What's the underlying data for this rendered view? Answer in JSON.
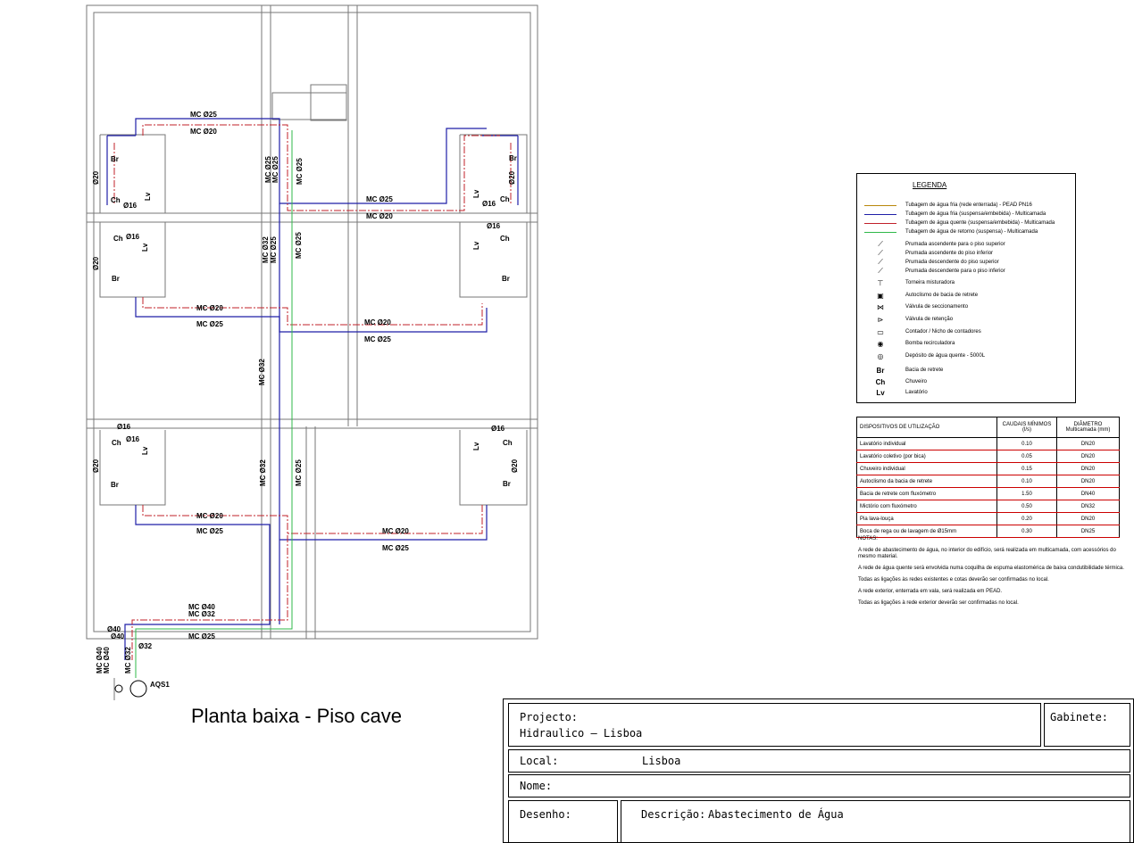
{
  "plan": {
    "title": "Planta baixa - Piso cave",
    "pipe_labels": [
      "MC Ø25",
      "MC Ø20",
      "MC Ø25",
      "MC Ø20",
      "MC Ø20",
      "MC Ø25",
      "MC Ø20",
      "MC Ø25",
      "MC Ø20",
      "MC Ø25",
      "MC Ø20",
      "MC Ø25",
      "MC Ø40",
      "MC Ø32",
      "MC Ø25"
    ],
    "vertical_labels": [
      "MC Ø25",
      "MC Ø25",
      "MC Ø25",
      "MC Ø32",
      "MC Ø25",
      "MC Ø25",
      "MC Ø32",
      "MC Ø32",
      "MC Ø25",
      "MC Ø40",
      "MC Ø40",
      "MC Ø32"
    ],
    "fixture_labels": [
      "Br",
      "Ch",
      "Lv",
      "Ø16",
      "Ø20"
    ],
    "aqs_label": "AQS1",
    "small_labels": [
      "Ø40",
      "Ø40",
      "Ø32"
    ]
  },
  "legend": {
    "title": "LEGENDA",
    "items": [
      {
        "symbol": "line",
        "color": "#b8860b",
        "text": "Tubagem de água fria (rede enterrada) - PEAD PN16"
      },
      {
        "symbol": "line",
        "color": "#1f1fa8",
        "text": "Tubagem de água fria (suspensa/embebida) - Multicamada"
      },
      {
        "symbol": "line",
        "color": "#c0202a",
        "text": "Tubagem de água quente (suspensa/embebida) - Multicamada"
      },
      {
        "symbol": "line",
        "color": "#2fb84a",
        "text": "Tubagem de água de retorno (suspensa) - Multicamada"
      },
      {
        "symbol": "riser-up",
        "text": "Prumada ascendente para o piso superior"
      },
      {
        "symbol": "riser-up-in",
        "text": "Prumada ascendente do piso inferior"
      },
      {
        "symbol": "riser-down-in",
        "text": "Prumada descendente do piso superior"
      },
      {
        "symbol": "riser-down",
        "text": "Prumada descendente para o piso inferior"
      },
      {
        "symbol": "mixer",
        "text": "Torneira misturadora"
      },
      {
        "symbol": "flush",
        "text": "Autoclismo de bacia de retrete"
      },
      {
        "symbol": "valve",
        "text": "Válvula de seccionamento"
      },
      {
        "symbol": "check",
        "text": "Válvula de retenção"
      },
      {
        "symbol": "meter",
        "text": "Contador / Nicho de contadores"
      },
      {
        "symbol": "pump",
        "text": "Bomba recirculadora"
      },
      {
        "symbol": "tank",
        "text": "Depósito de água quente - 5000L"
      },
      {
        "symbol": "Br",
        "text": "Bacia de retrete"
      },
      {
        "symbol": "Ch",
        "text": "Chuveiro"
      },
      {
        "symbol": "Lv",
        "text": "Lavatório"
      }
    ]
  },
  "devices_table": {
    "headers": [
      "DISPOSITIVOS DE UTILIZAÇÃO",
      "CAUDAIS MÍNIMOS",
      "(l/s)",
      "DIÂMETRO",
      "Multicamada (mm)"
    ],
    "rows": [
      [
        "Lavatório individual",
        "0.10",
        "DN20"
      ],
      [
        "Lavatório coletivo (por bica)",
        "0.05",
        "DN20"
      ],
      [
        "Chuveiro individual",
        "0.15",
        "DN20"
      ],
      [
        "Autoclismo da bacia de retrete",
        "0.10",
        "DN20"
      ],
      [
        "Bacia de retrete com fluxómetro",
        "1.50",
        "DN40"
      ],
      [
        "Mictório com fluxómetro",
        "0.50",
        "DN32"
      ],
      [
        "Pia lava-louça",
        "0.20",
        "DN20"
      ],
      [
        "Boca de rega ou de lavagem de Ø15mm",
        "0.30",
        "DN25"
      ]
    ]
  },
  "notes": {
    "title": "NOTAS:",
    "items": [
      "A rede de abastecimento de água, no interior do edifício, será realizada em multicamada, com acessórios do mesmo material.",
      "A rede de água quente será envolvida numa coquilha de espuma elastomérica de baixa condutibilidade térmica.",
      "Todas as ligações às redes existentes e cotas deverão ser confirmadas no local.",
      "A rede exterior, enterrada em vala, será realizada em PEAD.",
      "Todas as ligações à rede exterior deverão ser confirmadas no local."
    ]
  },
  "title_block": {
    "projecto_label": "Projecto:",
    "projecto_value": "Hidraulico – Lisboa",
    "gabinete_label": "Gabinete:",
    "local_label": "Local:",
    "local_value": "Lisboa",
    "nome_label": "Nome:",
    "desenho_label": "Desenho:",
    "descricao_label": "Descrição:",
    "descricao_value": "Abastecimento de Água"
  },
  "colors": {
    "cold_water": "#1f1fa8",
    "hot_water": "#c0202a",
    "return_water": "#2fb84a",
    "buried": "#b8860b"
  }
}
